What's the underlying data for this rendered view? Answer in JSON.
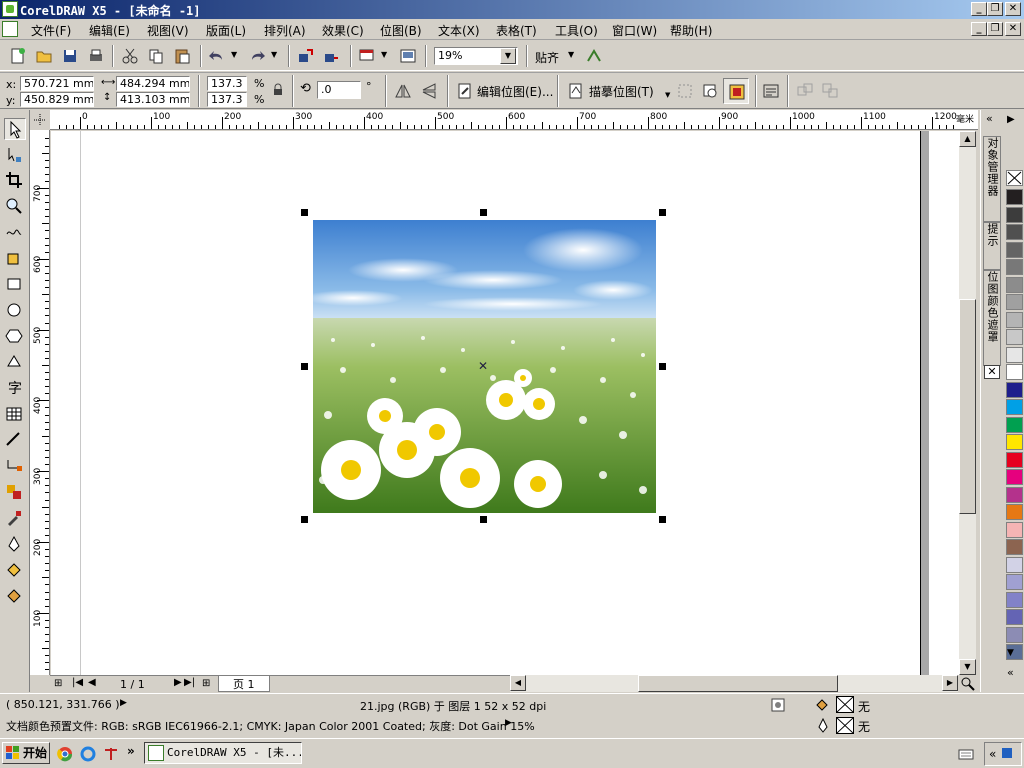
{
  "window": {
    "title": "CorelDRAW X5 - [未命名 -1]",
    "controls": {
      "minimize": "_",
      "restore": "❐",
      "close": "✕"
    }
  },
  "menu": [
    "文件(F)",
    "编辑(E)",
    "视图(V)",
    "版面(L)",
    "排列(A)",
    "效果(C)",
    "位图(B)",
    "文本(X)",
    "表格(T)",
    "工具(O)",
    "窗口(W)",
    "帮助(H)"
  ],
  "standard_toolbar": {
    "zoom_value": "19%",
    "snap_label": "贴齐"
  },
  "property_bar": {
    "x_label": "x:",
    "x_value": "570.721 mm",
    "y_label": "y:",
    "y_value": "450.829 mm",
    "width_value": "484.294 mm",
    "height_value": "413.103 mm",
    "scale_w": "137.3",
    "scale_h": "137.3",
    "percent": "%",
    "rotation_value": ".0",
    "degree": "°",
    "edit_bitmap_label": "编辑位图(E)...",
    "trace_bitmap_label": "描摹位图(T)"
  },
  "ruler": {
    "unit": "毫米",
    "h_labels": [
      "0",
      "100",
      "200",
      "300",
      "400",
      "500",
      "600",
      "700",
      "800",
      "900",
      "1000",
      "1100",
      "1200"
    ],
    "v_labels": [
      "700",
      "600",
      "500",
      "400",
      "300",
      "200",
      "100"
    ]
  },
  "dockers": {
    "object_manager": "对象管理器",
    "hints": "提示",
    "bitmap_color_mask": "位图颜色遮罩"
  },
  "palette": {
    "colors": [
      "#231f20",
      "#3c3c3c",
      "#505050",
      "#646464",
      "#787878",
      "#8c8c8c",
      "#a0a0a0",
      "#b4b4b4",
      "#c8c8c8",
      "#e6e6e6",
      "#ffffff",
      "#1e1e8c",
      "#00a0e6",
      "#00a050",
      "#ffe600",
      "#e6001e",
      "#e6007e",
      "#b4328c",
      "#e67814",
      "#f5b4b4",
      "#8c6450",
      "#d2d2e6",
      "#a0a0d2",
      "#8282c8",
      "#6464b4",
      "#8c8cb4",
      "#5a6e96"
    ]
  },
  "page_nav": {
    "page_count": "1 / 1",
    "page_tab": "页 1"
  },
  "status": {
    "coords": "( 850.121, 331.766 )",
    "object_info": "21.jpg (RGB) 于 图层 1 52 x 52 dpi",
    "color_profile": "文档颜色预置文件: RGB: sRGB IEC61966-2.1; CMYK: Japan Color 2001 Coated; 灰度: Dot Gain 15%",
    "fill_none": "无",
    "outline_none": "无"
  },
  "taskbar": {
    "start_label": "开始",
    "task_label": "CorelDRAW X5 - [未..."
  }
}
